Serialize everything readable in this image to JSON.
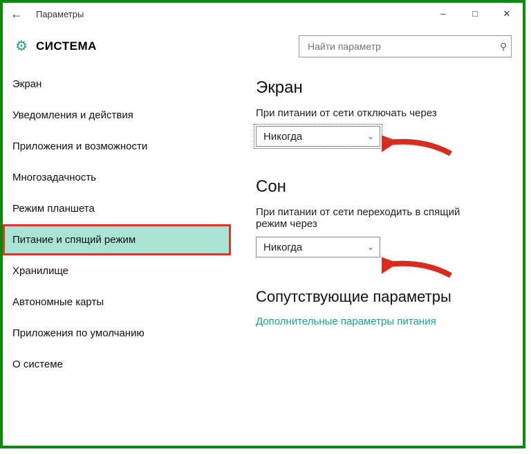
{
  "window": {
    "title": "Параметры"
  },
  "header": {
    "page_title": "СИСТЕМА",
    "search_placeholder": "Найти параметр"
  },
  "sidebar": {
    "items": [
      {
        "label": "Экран"
      },
      {
        "label": "Уведомления и действия"
      },
      {
        "label": "Приложения и возможности"
      },
      {
        "label": "Многозадачность"
      },
      {
        "label": "Режим планшета"
      },
      {
        "label": "Питание и спящий режим"
      },
      {
        "label": "Хранилище"
      },
      {
        "label": "Автономные карты"
      },
      {
        "label": "Приложения по умолчанию"
      },
      {
        "label": "О системе"
      }
    ],
    "active_index": 5
  },
  "content": {
    "screen": {
      "heading": "Экран",
      "label": "При питании от сети отключать через",
      "value": "Никогда"
    },
    "sleep": {
      "heading": "Сон",
      "label": "При питании от сети переходить в спящий режим через",
      "value": "Никогда"
    },
    "related": {
      "heading": "Сопутствующие параметры",
      "link": "Дополнительные параметры питания"
    }
  }
}
